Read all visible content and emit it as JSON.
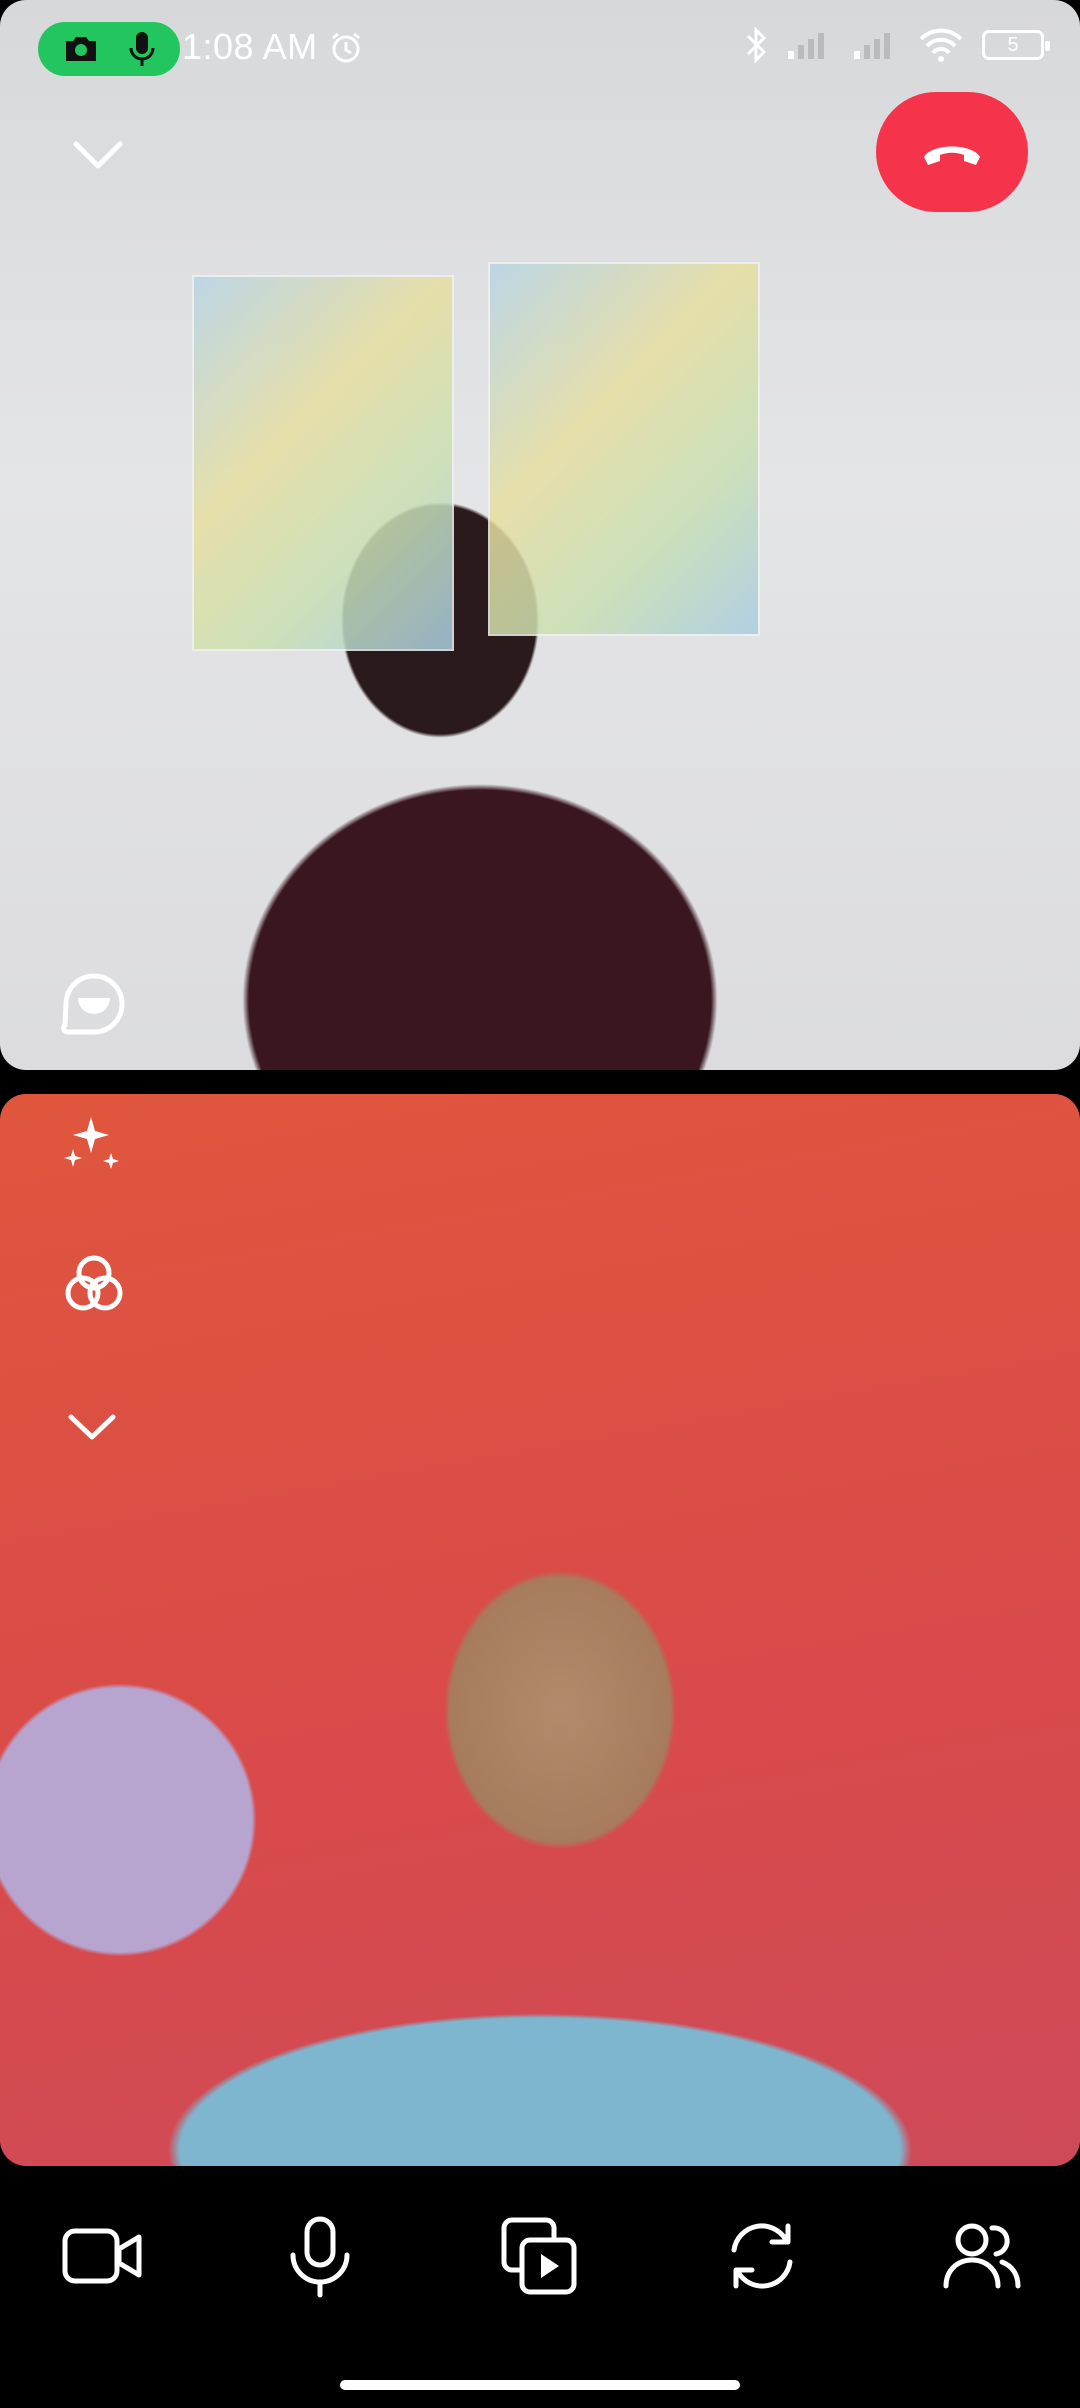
{
  "status_bar": {
    "time": "1:08 AM",
    "battery_level": "5",
    "icons": [
      "camera-icon",
      "microphone-icon",
      "alarm-icon",
      "bluetooth-icon",
      "signal-icon",
      "signal-icon",
      "wifi-icon",
      "battery-icon"
    ],
    "recording_pill_color": "#22c55e"
  },
  "call": {
    "end_call_color": "#f5334a",
    "remote_controls": [
      "collapse-chevron-icon",
      "end-call-icon",
      "reactions-icon"
    ],
    "self_controls": [
      "effects-sparkle-icon",
      "filters-icon",
      "more-chevron-icon"
    ]
  },
  "bottom_toolbar": {
    "buttons": [
      "video-camera-icon",
      "microphone-icon",
      "share-media-icon",
      "flip-camera-icon",
      "participants-icon"
    ]
  }
}
